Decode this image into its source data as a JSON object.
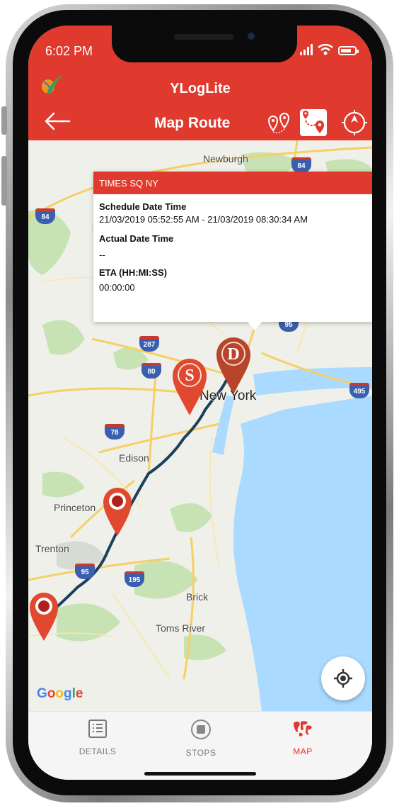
{
  "status_bar": {
    "time": "6:02 PM",
    "battery_level": 0.8
  },
  "header": {
    "app_title": "YLogLite",
    "page_title": "Map Route",
    "accent_color": "#e0392d",
    "icons": [
      "back-arrow-icon",
      "route-pins-icon",
      "map-route-icon",
      "compass-icon"
    ]
  },
  "map": {
    "labels": {
      "newburgh": "Newburgh",
      "new_york": "New York",
      "edison": "Edison",
      "princeton": "Princeton",
      "trenton": "Trenton",
      "brick": "Brick",
      "toms_river": "Toms River"
    },
    "shields": [
      "84",
      "84",
      "287",
      "80",
      "95",
      "78",
      "495",
      "95",
      "195"
    ],
    "markers": {
      "start": "S",
      "destination": "D"
    },
    "google_logo": "Google"
  },
  "popup": {
    "title": "TIMES SQ NY",
    "schedule_label": "Schedule Date Time",
    "schedule_value": "21/03/2019 05:52:55 AM - 21/03/2019 08:30:34 AM",
    "actual_label": "Actual Date Time",
    "actual_value": "--",
    "eta_label": "ETA (HH:MI:SS)",
    "eta_value": "00:00:00"
  },
  "tabs": [
    {
      "label": "DETAILS",
      "icon": "list-icon",
      "active": false
    },
    {
      "label": "STOPS",
      "icon": "stop-icon",
      "active": false
    },
    {
      "label": "MAP",
      "icon": "world-map-icon",
      "active": true
    }
  ]
}
